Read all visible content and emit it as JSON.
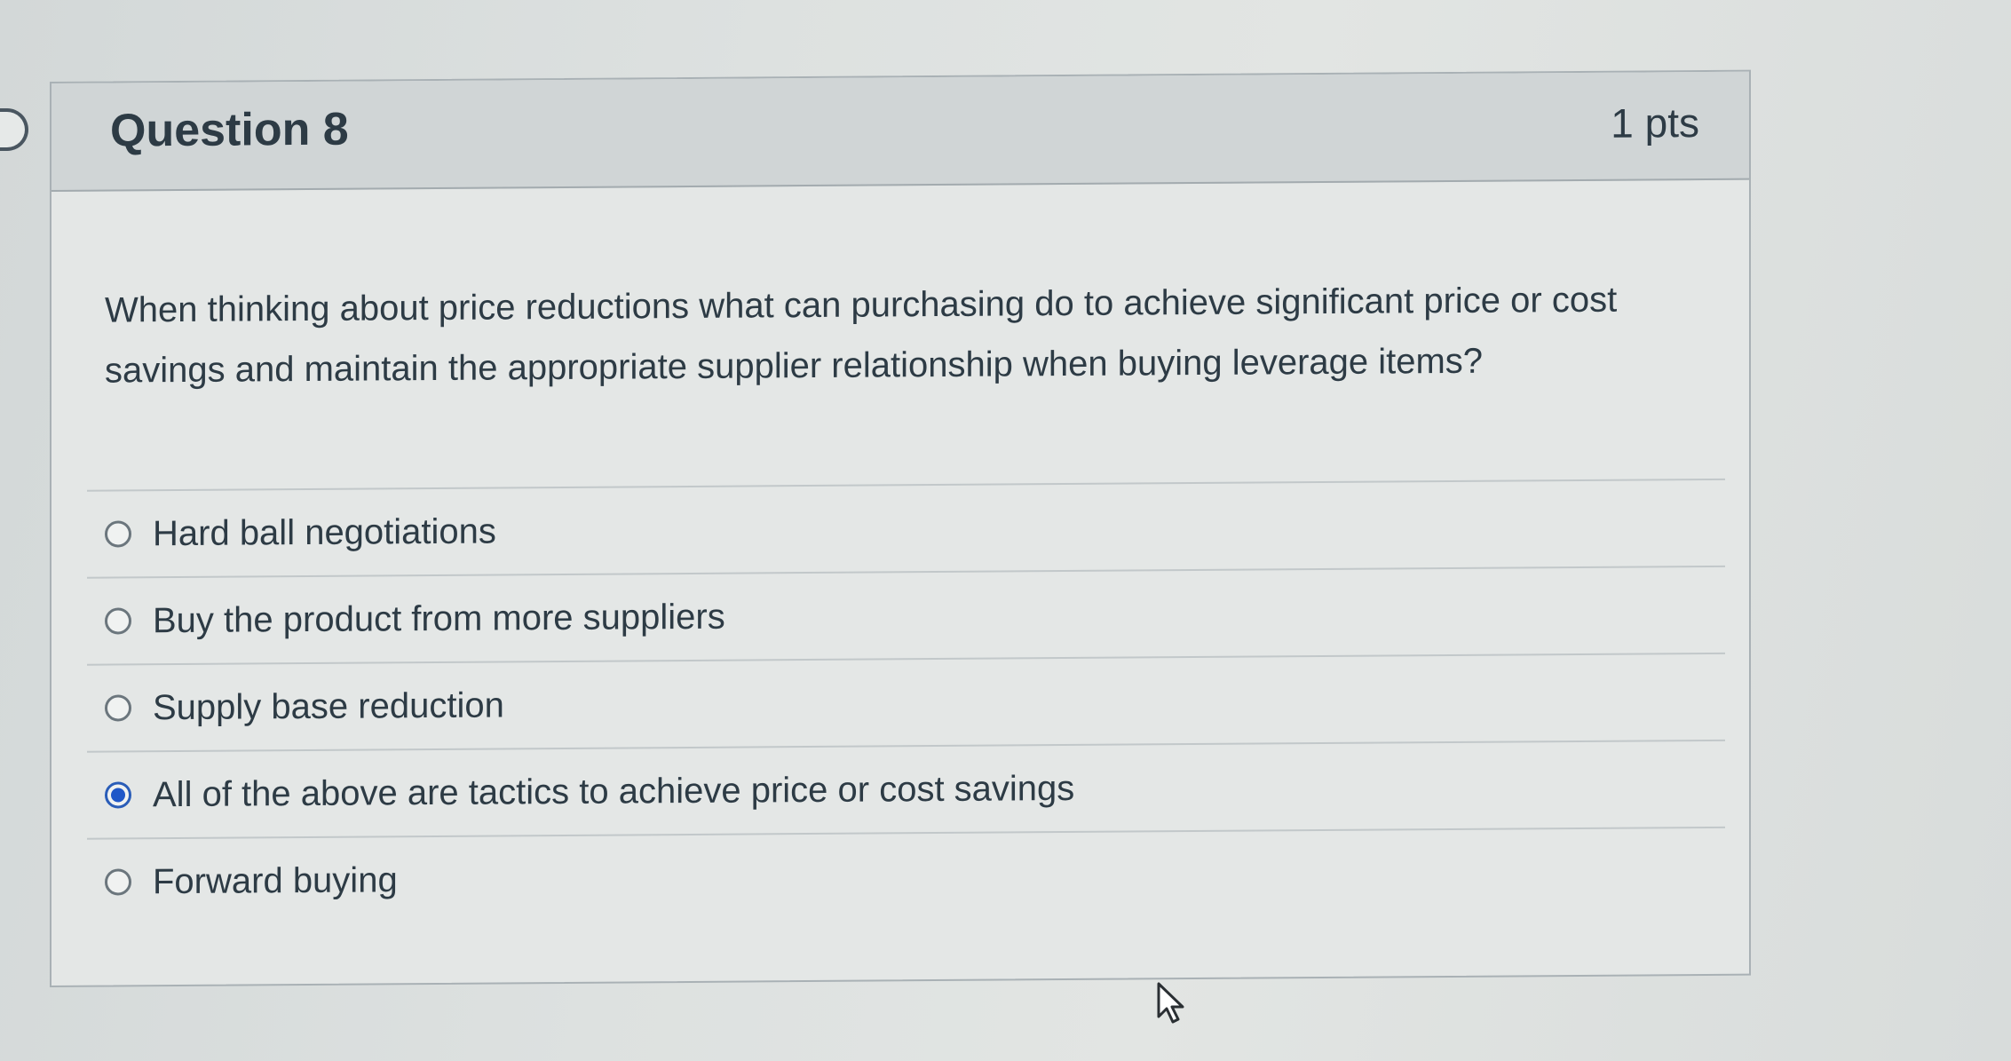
{
  "question": {
    "title": "Question 8",
    "points": "1 pts",
    "text": "When thinking about price reductions what can purchasing do to achieve significant price or cost savings and maintain the appropriate supplier relationship when buying leverage items?"
  },
  "answers": [
    {
      "label": "Hard ball negotiations",
      "selected": false
    },
    {
      "label": "Buy the product from more suppliers",
      "selected": false
    },
    {
      "label": "Supply base reduction",
      "selected": false
    },
    {
      "label": "All of the above are tactics to achieve price or cost savings",
      "selected": true
    },
    {
      "label": "Forward buying",
      "selected": false
    }
  ],
  "colors": {
    "accent": "#1f57c8",
    "text": "#2d3b45",
    "header_bg": "#d0d5d6"
  },
  "icons": {
    "nav_flag": "question-flag-icon",
    "cursor": "mouse-pointer-icon"
  }
}
